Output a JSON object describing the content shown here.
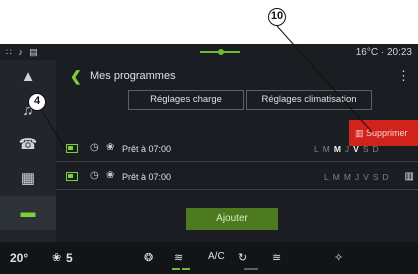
{
  "callouts": {
    "c10": "10",
    "c4": "4"
  },
  "status_bar": {
    "left_icons": "∷ ♪ ▤",
    "right": "16°C · 20:23"
  },
  "nav": [
    {
      "icon": "home-icon",
      "glyph": "▲"
    },
    {
      "icon": "music-icon",
      "glyph": "♫"
    },
    {
      "icon": "phone-icon",
      "glyph": "☎"
    },
    {
      "icon": "apps-icon",
      "glyph": "▦"
    },
    {
      "icon": "car-icon",
      "glyph": "▬"
    }
  ],
  "header": {
    "back_glyph": "❮",
    "title": "Mes programmes",
    "menu_glyph": "⋮"
  },
  "tabs": {
    "charge": "Réglages charge",
    "climatisation": "Réglages climatisation"
  },
  "rows": [
    {
      "label": "Prêt à 07:00",
      "days": [
        "L",
        "M",
        "M",
        "J",
        "V",
        "S",
        "D"
      ],
      "active_days": [
        false,
        false,
        true,
        false,
        true,
        false,
        false
      ]
    },
    {
      "label": "Prêt à 07:00",
      "days": [
        "L",
        "M",
        "M",
        "J",
        "V",
        "S",
        "D"
      ],
      "active_days": [
        false,
        false,
        false,
        false,
        false,
        false,
        false
      ]
    }
  ],
  "icons": {
    "clock": "◷",
    "fan": "❀",
    "trash": "▥"
  },
  "buttons": {
    "delete": "Supprimer",
    "add": "Ajouter"
  },
  "bottom_bar": {
    "temp": "20",
    "temp_unit": "°",
    "fan_glyph": "❀",
    "fan_level": "5",
    "seat_glyph": "❂",
    "heated_seat_glyph": "≋",
    "ac": "A/C",
    "recirc_glyph": "↻",
    "defrost_glyph": "≊",
    "vent_glyph": "✧"
  },
  "colors": {
    "accent": "#7fcf3a",
    "delete": "#d0231c",
    "add": "#4d7a1f",
    "screen": "#1a1d22"
  }
}
